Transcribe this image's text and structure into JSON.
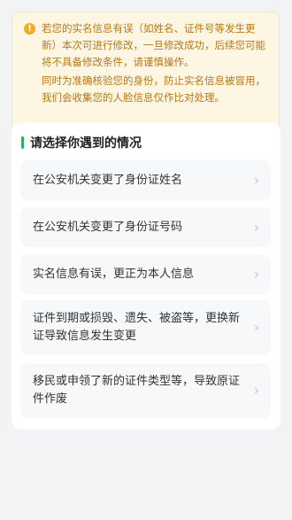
{
  "notice": {
    "icon": "exclamation-circle-icon",
    "line1": "若您的实名信息有误（如姓名、证件号等发生更新）本次可进行修改，一旦修改成功，后续您可能将不具备修改条件，请谨慎操作。",
    "line2": "同时为准确核验您的身份，防止实名信息被冒用，我们会收集您的人脸信息仅作比对处理。"
  },
  "section": {
    "title": "请选择你遇到的情况",
    "options": [
      {
        "label": "在公安机关变更了身份证姓名"
      },
      {
        "label": "在公安机关变更了身份证号码"
      },
      {
        "label": "实名信息有误，更正为本人信息"
      },
      {
        "label": "证件到期或损毁、遗失、被盗等，更换新证导致信息发生变更"
      },
      {
        "label": "移民或申领了新的证件类型等，导致原证件作废"
      }
    ]
  },
  "colors": {
    "accent": "#22b55a",
    "warning": "#f2ab24",
    "warning_text": "#b87818"
  }
}
